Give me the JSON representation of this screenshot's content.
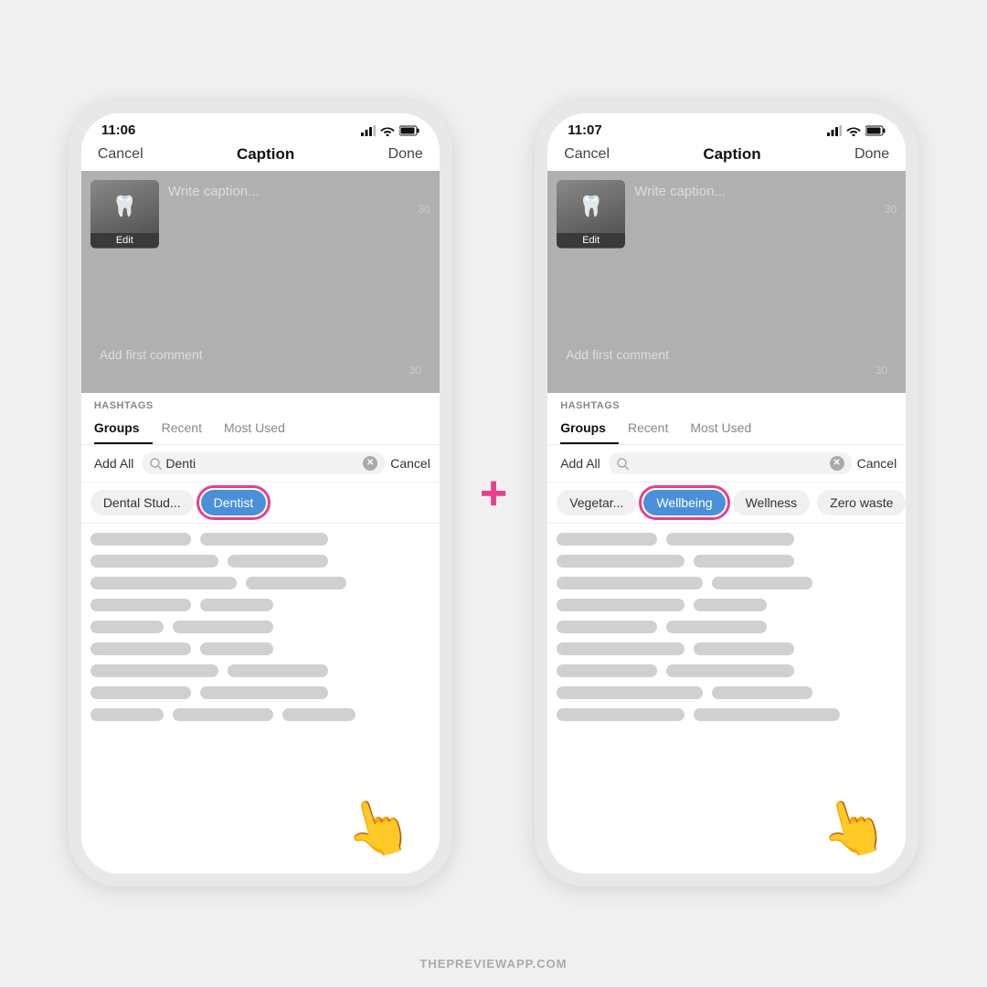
{
  "phone1": {
    "status_time": "11:06",
    "nav": {
      "cancel": "Cancel",
      "title": "Caption",
      "done": "Done"
    },
    "caption": {
      "placeholder": "Write caption...",
      "edit_label": "Edit",
      "char_count": "30",
      "comment_placeholder": "Add first comment",
      "comment_char_count": "30"
    },
    "hashtags": {
      "label": "HASHTAGS",
      "tabs": [
        "Groups",
        "Recent",
        "Most Used"
      ],
      "active_tab": "Groups"
    },
    "search": {
      "add_all": "Add All",
      "input_value": "Denti",
      "cancel": "Cancel"
    },
    "chips": [
      "Dental Stud...",
      "Dentist"
    ],
    "selected_chip": "Dentist",
    "hashtag_rows": [
      [
        "w-md",
        "w-lg"
      ],
      [
        "w-lg",
        "w-md"
      ],
      [
        "w-xl",
        "w-md"
      ],
      [
        "w-md",
        "w-sm"
      ],
      [
        "w-sm",
        "w-md"
      ],
      [
        "w-md",
        "w-sm"
      ],
      [
        "w-lg",
        "w-md"
      ],
      [
        "w-md",
        "w-lg"
      ],
      [
        "w-sm",
        "w-md",
        "w-sm"
      ]
    ]
  },
  "phone2": {
    "status_time": "11:07",
    "nav": {
      "cancel": "Cancel",
      "title": "Caption",
      "done": "Done"
    },
    "caption": {
      "placeholder": "Write caption...",
      "edit_label": "Edit",
      "char_count": "30",
      "comment_placeholder": "Add first comment",
      "comment_char_count": "30"
    },
    "hashtags": {
      "label": "HASHTAGS",
      "tabs": [
        "Groups",
        "Recent",
        "Most Used"
      ],
      "active_tab": "Groups"
    },
    "search": {
      "add_all": "Add All",
      "input_value": "",
      "cancel": "Cancel"
    },
    "chips": [
      "Vegetar...",
      "Wellbeing",
      "Wellness",
      "Zero waste"
    ],
    "selected_chip": "Wellbeing",
    "hashtag_rows": [
      [
        "w-md",
        "w-lg"
      ],
      [
        "w-lg",
        "w-md"
      ],
      [
        "w-xl",
        "w-md"
      ],
      [
        "w-lg",
        "w-sm"
      ],
      [
        "w-md",
        "w-md"
      ],
      [
        "w-lg",
        "w-md"
      ],
      [
        "w-md",
        "w-lg"
      ],
      [
        "w-xl",
        "w-md"
      ],
      [
        "w-lg",
        "w-xl"
      ]
    ]
  },
  "footer": "THEPREVIEWAPP.COM"
}
